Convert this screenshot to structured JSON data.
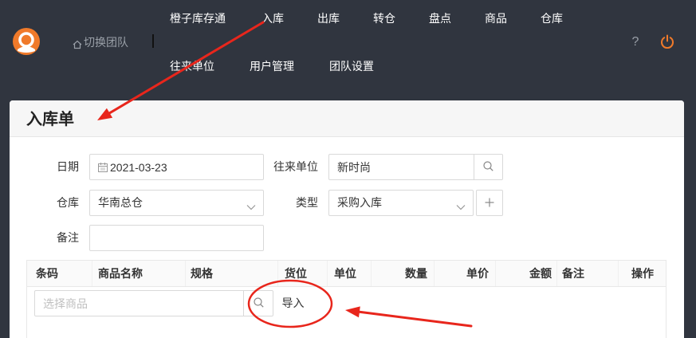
{
  "header": {
    "team_switch_label": "切换团队",
    "nav_row1": [
      "橙子库存通",
      "入库",
      "出库",
      "转仓",
      "盘点",
      "商品",
      "仓库"
    ],
    "nav_row2": [
      "往来单位",
      "用户管理",
      "团队设置"
    ],
    "help_label": "?",
    "icons": [
      "logo",
      "home-icon",
      "power-icon"
    ]
  },
  "page": {
    "title": "入库单"
  },
  "form": {
    "date": {
      "label": "日期",
      "value": "2021-03-23",
      "icon": "calendar-icon"
    },
    "partner": {
      "label": "往来单位",
      "value": "新时尚",
      "button_icon": "search-icon"
    },
    "warehouse": {
      "label": "仓库",
      "value": "华南总仓",
      "icon": "chevron-down-icon"
    },
    "type": {
      "label": "类型",
      "value": "采购入库",
      "icon": "chevron-down-icon",
      "add_icon": "plus-icon"
    },
    "remark": {
      "label": "备注",
      "value": ""
    }
  },
  "table": {
    "columns": [
      "条码",
      "商品名称",
      "规格",
      "货位",
      "单位",
      "数量",
      "单价",
      "金额",
      "备注",
      "操作"
    ],
    "product_picker_placeholder": "选择商品",
    "import_label": "导入"
  },
  "colors": {
    "nav_bg": "#30353f",
    "accent": "#f07a2a",
    "annotation": "#e8261c"
  }
}
